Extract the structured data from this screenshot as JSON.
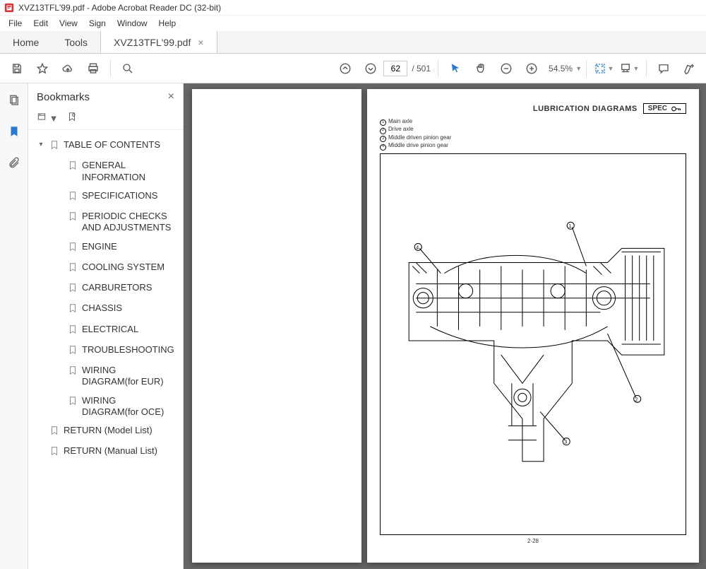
{
  "titlebar": {
    "text": "XVZ13TFL'99.pdf - Adobe Acrobat Reader DC (32-bit)"
  },
  "menubar": [
    "File",
    "Edit",
    "View",
    "Sign",
    "Window",
    "Help"
  ],
  "tabs": {
    "home": "Home",
    "tools": "Tools",
    "doc": "XVZ13TFL'99.pdf"
  },
  "toolbar": {
    "page_current": "62",
    "page_total": "/ 501",
    "zoom": "54.5%"
  },
  "bookmarks": {
    "title": "Bookmarks",
    "root": "TABLE OF CONTENTS",
    "children": [
      "GENERAL INFORMATION",
      "SPECIFICATIONS",
      "PERIODIC CHECKS AND ADJUSTMENTS",
      "ENGINE",
      "COOLING SYSTEM",
      "CARBURETORS",
      "CHASSIS",
      "ELECTRICAL",
      "TROUBLESHOOTING",
      "WIRING DIAGRAM(for EUR)",
      "WIRING DIAGRAM(for OCE)"
    ],
    "siblings": [
      "RETURN (Model List)",
      "RETURN (Manual List)"
    ]
  },
  "page": {
    "title": "LUBRICATION DIAGRAMS",
    "spec": "SPEC",
    "legend": [
      "Main axle",
      "Drive axle",
      "Middle driven pinion gear",
      "Middle drive pinion gear"
    ],
    "pagenum": "2-28"
  }
}
